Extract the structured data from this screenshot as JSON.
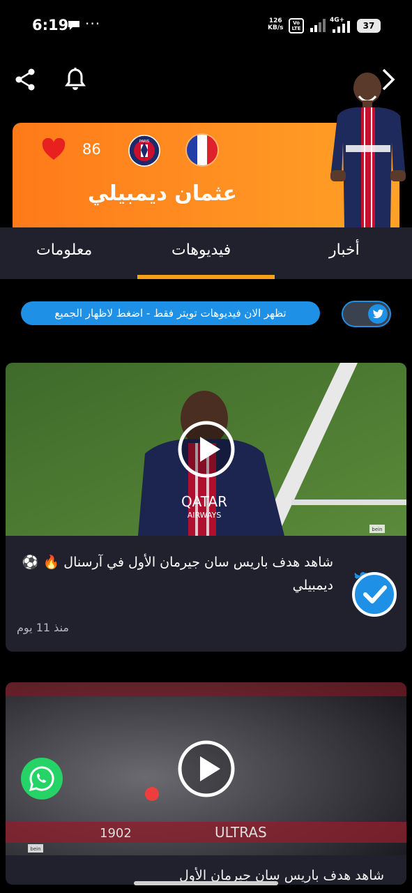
{
  "status_bar": {
    "time": "6:19",
    "dots": "···",
    "speed_value": "126",
    "speed_unit": "KB/s",
    "volte_line1": "Vo",
    "volte_line2": "LTE",
    "network": "4G+",
    "battery": "37"
  },
  "header": {
    "likes": "86",
    "player_name": "عثمان ديمبيلي",
    "club_badge_text": "PARIS",
    "accent_gradient": [
      "#ff7a1a",
      "#ffa227"
    ]
  },
  "tabs": [
    {
      "label": "معلومات",
      "active": false
    },
    {
      "label": "فيديوهات",
      "active": true
    },
    {
      "label": "أخبار",
      "active": false
    }
  ],
  "filter": {
    "message": "تظهر الان فيديوهات تويتر فقط - اضغط لاظهار الجميع",
    "twitter_only": true
  },
  "videos": [
    {
      "title": "شاهد هدف باريس سان جيرمان الأول في آرسنال 🔥 ⚽️ديمبيلي",
      "time_ago": "منذ 11 يوم",
      "source": "twitter",
      "shirt_sponsor": "QATAR",
      "shirt_sponsor_2": "AIRWAYS",
      "watermark": "bein"
    },
    {
      "title": "شاهد هدف باريس سان جيرمان الأول",
      "banner_1": "1902",
      "banner_2": "ULTRAS",
      "watermark": "bein"
    }
  ],
  "colors": {
    "accent": "#f5a314",
    "twitter": "#1e90e6",
    "card_bg": "#21212d",
    "heart": "#e8201f",
    "whatsapp": "#25d366"
  },
  "icons": [
    "share-icon",
    "bell-icon",
    "chevron-right-icon",
    "heart-icon",
    "play-icon",
    "twitter-icon",
    "verified-check-icon",
    "whatsapp-icon"
  ]
}
